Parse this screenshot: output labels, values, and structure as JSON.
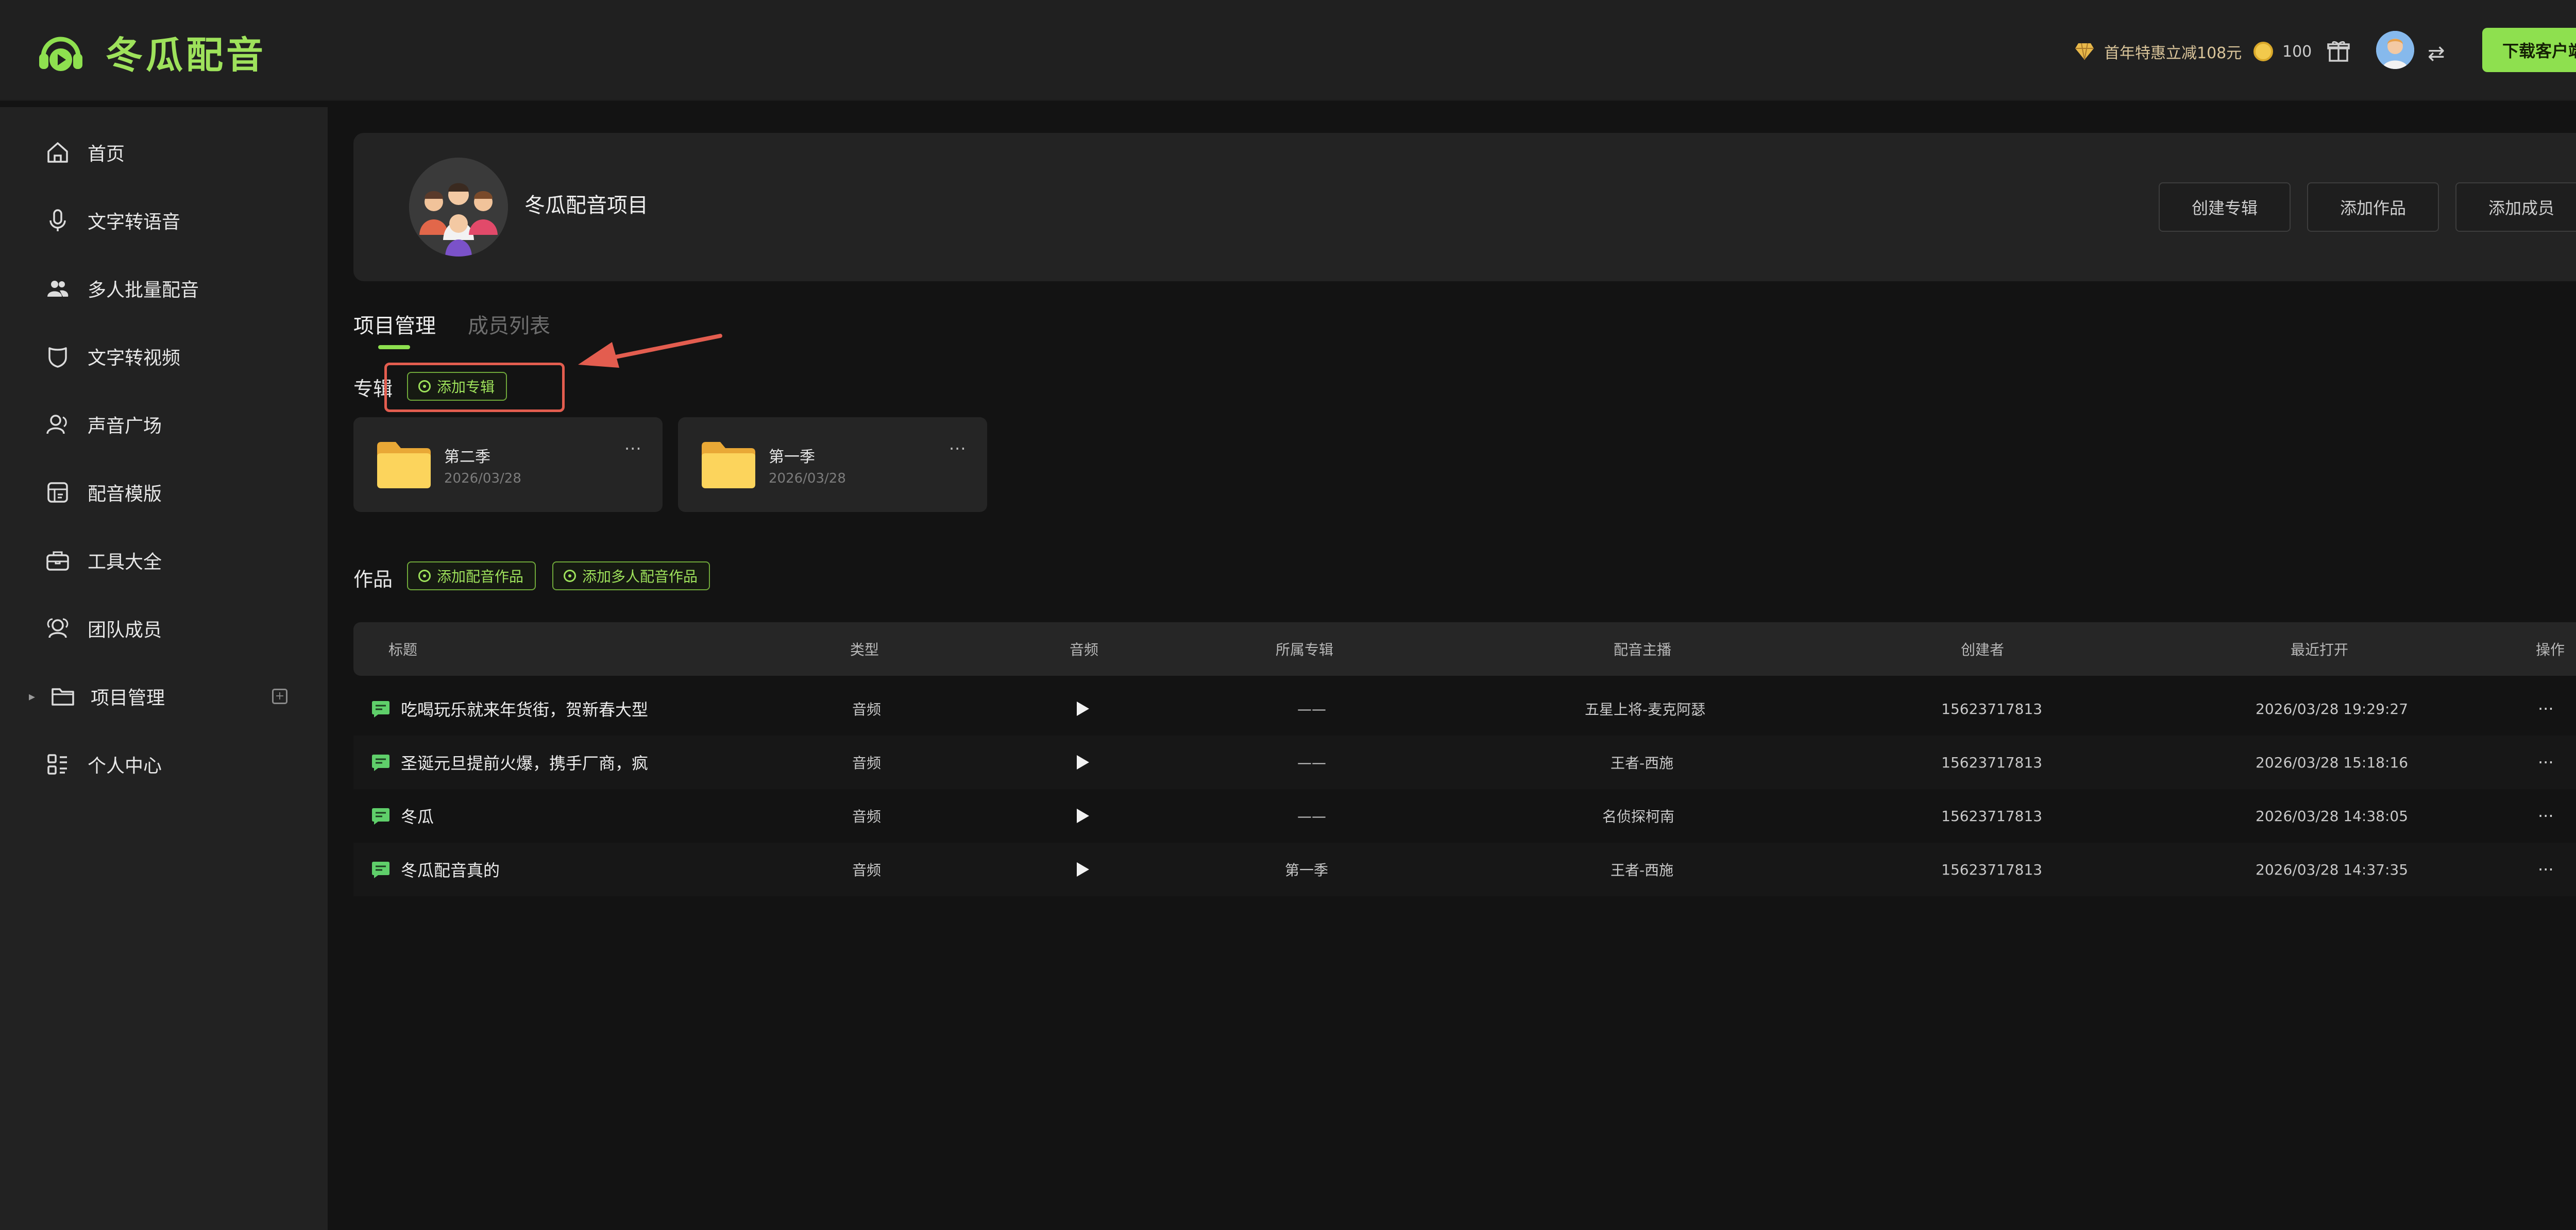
{
  "header": {
    "app_name": "冬瓜配音",
    "promo_text": "首年特惠立减108元",
    "coin_count": "100",
    "download_label": "下载客户端",
    "switch_glyph": "⇄"
  },
  "sidebar": {
    "items": [
      {
        "label": "首页",
        "icon": "home-icon"
      },
      {
        "label": "文字转语音",
        "icon": "microphone-icon"
      },
      {
        "label": "多人批量配音",
        "icon": "users-icon"
      },
      {
        "label": "文字转视频",
        "icon": "shield-icon"
      },
      {
        "label": "声音广场",
        "icon": "person-icon"
      },
      {
        "label": "配音模版",
        "icon": "template-icon"
      },
      {
        "label": "工具大全",
        "icon": "toolbox-icon"
      },
      {
        "label": "团队成员",
        "icon": "team-icon"
      },
      {
        "label": "项目管理",
        "icon": "folder-icon"
      },
      {
        "label": "个人中心",
        "icon": "grid-icon"
      }
    ],
    "expand_glyph": "▸",
    "add_glyph": "+"
  },
  "project": {
    "name": "冬瓜配音项目",
    "buttons": {
      "create_album": "创建专辑",
      "add_work": "添加作品",
      "add_member": "添加成员"
    }
  },
  "tabs": [
    {
      "label": "项目管理",
      "active": true
    },
    {
      "label": "成员列表",
      "active": false
    }
  ],
  "albums_section": {
    "label": "专辑",
    "add_label": "添加专辑",
    "items": [
      {
        "name": "第二季",
        "date": "2026/03/28"
      },
      {
        "name": "第一季",
        "date": "2026/03/28"
      }
    ],
    "more_glyph": "···"
  },
  "works_section": {
    "label": "作品",
    "add_label": "添加配音作品",
    "add_multi_label": "添加多人配音作品"
  },
  "table": {
    "columns": [
      "标题",
      "类型",
      "音频",
      "所属专辑",
      "配音主播",
      "创建者",
      "最近打开",
      "操作"
    ],
    "rows": [
      {
        "title": "吃喝玩乐就来年货街，贺新春大型",
        "type": "音频",
        "album": "——",
        "anchor": "五星上将-麦克阿瑟",
        "creator": "15623717813",
        "opened": "2026/03/28 19:29:27"
      },
      {
        "title": "圣诞元旦提前火爆，携手厂商，疯",
        "type": "音频",
        "album": "——",
        "anchor": "王者-西施",
        "creator": "15623717813",
        "opened": "2026/03/28 15:18:16"
      },
      {
        "title": "冬瓜",
        "type": "音频",
        "album": "——",
        "anchor": "名侦探柯南",
        "creator": "15623717813",
        "opened": "2026/03/28 14:38:05"
      },
      {
        "title": "冬瓜配音真的",
        "type": "音频",
        "album": "第一季",
        "anchor": "王者-西施",
        "creator": "15623717813",
        "opened": "2026/03/28 14:37:35"
      }
    ],
    "more_glyph": "···"
  },
  "colors": {
    "accent": "#8ee04f",
    "highlight": "#e35d4f",
    "background": "#131313",
    "sidebar": "#222222"
  }
}
